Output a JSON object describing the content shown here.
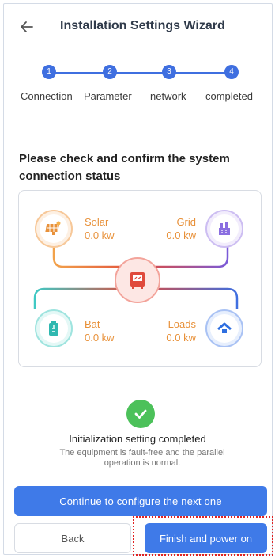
{
  "header": {
    "title": "Installation Settings Wizard"
  },
  "steps": [
    {
      "num": "1",
      "label": "Connection"
    },
    {
      "num": "2",
      "label": "Parameter"
    },
    {
      "num": "3",
      "label": "network"
    },
    {
      "num": "4",
      "label": "completed"
    }
  ],
  "confirm_title": "Please check and confirm the system connection status",
  "diagram": {
    "solar": {
      "name": "Solar",
      "value": "0.0 kw"
    },
    "grid": {
      "name": "Grid",
      "value": "0.0 kw"
    },
    "bat": {
      "name": "Bat",
      "value": "0.0 kw"
    },
    "loads": {
      "name": "Loads",
      "value": "0.0 kw"
    }
  },
  "status": {
    "title": "Initialization setting completed",
    "description": "The equipment is fault-free and the parallel operation is normal."
  },
  "buttons": {
    "continue": "Continue to configure the next one",
    "back": "Back",
    "finish": "Finish and power on"
  },
  "colors": {
    "accent": "#3f7ae8",
    "success": "#4cc15a",
    "label": "#e8913a",
    "highlight": "#e12222"
  }
}
